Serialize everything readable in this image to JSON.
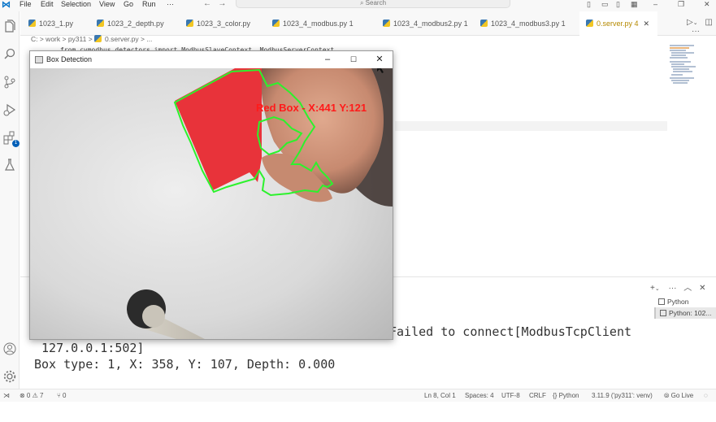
{
  "menu": {
    "items": [
      "File",
      "Edit",
      "Selection",
      "View",
      "Go",
      "Run",
      "···"
    ],
    "search_placeholder": "Search"
  },
  "tabs": [
    {
      "label": "1023_1.py",
      "active": false,
      "modified": ""
    },
    {
      "label": "1023_2_depth.py",
      "active": false,
      "modified": ""
    },
    {
      "label": "1023_3_color.py",
      "active": false,
      "modified": ""
    },
    {
      "label": "1023_4_modbus.py 1",
      "active": false,
      "modified": ""
    },
    {
      "label": "1023_4_modbus2.py 1",
      "active": false,
      "modified": ""
    },
    {
      "label": "1023_4_modbus3.py 1",
      "active": false,
      "modified": ""
    },
    {
      "label": "0.server.py 4",
      "active": true,
      "modified": ""
    }
  ],
  "breadcrumb": {
    "path": "C: > work > py311 > ",
    "file": "0.server.py > ..."
  },
  "editor": {
    "code_line": "from cvmodbus_detectors import ModbusSlaveContext, ModbusServerContext"
  },
  "box_window": {
    "title": "Box Detection",
    "label": "Red Box - X:441 Y:121",
    "label_color": "#ff1a1a",
    "contour_color": "#2cf22c"
  },
  "terminal": {
    "lines": [
      "Failed to connect[ModbusTcpClient",
      " 127.0.0.1:502]",
      "Box type: 1, X: 358, Y: 107, Depth: 0.000"
    ],
    "list": [
      "Python",
      "Python: 102..."
    ]
  },
  "status": {
    "problems": "⊗ 0 ⚠ 7",
    "ports": "⑂ 0",
    "position": "Ln 8, Col 1",
    "spaces": "Spaces: 4",
    "encoding": "UTF-8",
    "eol": "CRLF",
    "language": "{} Python",
    "interpreter": "3.11.9 ('py311': venv)",
    "golive": "Go Live"
  },
  "colors": {
    "accent": "#005fb8",
    "red_box": "#e8333a",
    "contour": "#2cf22c"
  }
}
